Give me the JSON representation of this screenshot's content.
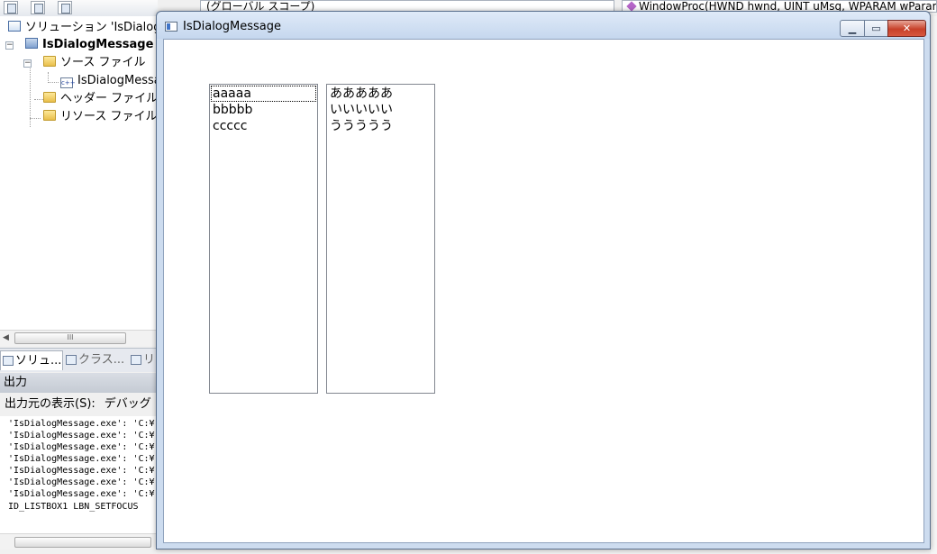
{
  "ide": {
    "scope_bar_text": "(グローバル スコープ)",
    "function_bar_text": "WindowProc(HWND hwnd, UINT uMsg, WPARAM wParam",
    "solution_explorer": {
      "items": [
        {
          "label": "ソリューション 'IsDialogMessage'",
          "icon": "solution-icon"
        },
        {
          "label": "IsDialogMessage",
          "icon": "project-icon"
        },
        {
          "label": "ソース ファイル",
          "icon": "folder-icon"
        },
        {
          "label": "IsDialogMessage.cpp",
          "icon": "cpp-file-icon"
        },
        {
          "label": "ヘッダー ファイル",
          "icon": "folder-icon"
        },
        {
          "label": "リソース ファイル",
          "icon": "folder-icon"
        }
      ],
      "cpp_icon_text": "c++",
      "scroll_thumb_text": "III"
    },
    "tabs": [
      {
        "label": "ソリュ..."
      },
      {
        "label": "クラス..."
      },
      {
        "label": "リ"
      }
    ],
    "output": {
      "header": "出力",
      "source_label": "出力元の表示(S):",
      "source_value": "デバッグ",
      "lines": [
        "'IsDialogMessage.exe': 'C:¥",
        "'IsDialogMessage.exe': 'C:¥",
        "'IsDialogMessage.exe': 'C:¥",
        "'IsDialogMessage.exe': 'C:¥",
        "'IsDialogMessage.exe': 'C:¥",
        "'IsDialogMessage.exe': 'C:¥",
        "'IsDialogMessage.exe': 'C:¥",
        "ID_LISTBOX1 LBN_SETFOCUS"
      ]
    }
  },
  "dialog": {
    "title": "IsDialogMessage",
    "minimize_glyph": "▁",
    "maximize_glyph": "▭",
    "close_glyph": "✕",
    "listbox1": {
      "items": [
        "aaaaa",
        "bbbbb",
        "ccccc"
      ],
      "focused_index": 0
    },
    "listbox2": {
      "items": [
        "あああああ",
        "いいいいい",
        "ううううう"
      ]
    }
  },
  "colors": {
    "close_button": "#c7412a",
    "title_bar": "#cddcef"
  }
}
